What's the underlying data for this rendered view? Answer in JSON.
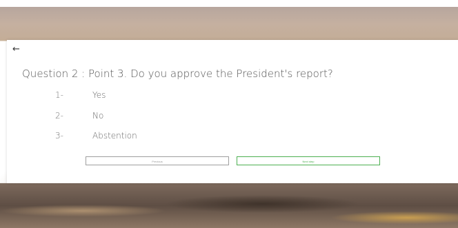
{
  "question": {
    "prefix": "Question 2 : ",
    "text": "Point 3. Do you approve the President's report?"
  },
  "options": [
    {
      "num": "1-",
      "label": "Yes"
    },
    {
      "num": "2-",
      "label": "No"
    },
    {
      "num": "3-",
      "label": "Abstention"
    }
  ],
  "buttons": {
    "previous": "Previous",
    "next": "Next step"
  },
  "icons": {
    "back": "arrow-left-icon"
  }
}
